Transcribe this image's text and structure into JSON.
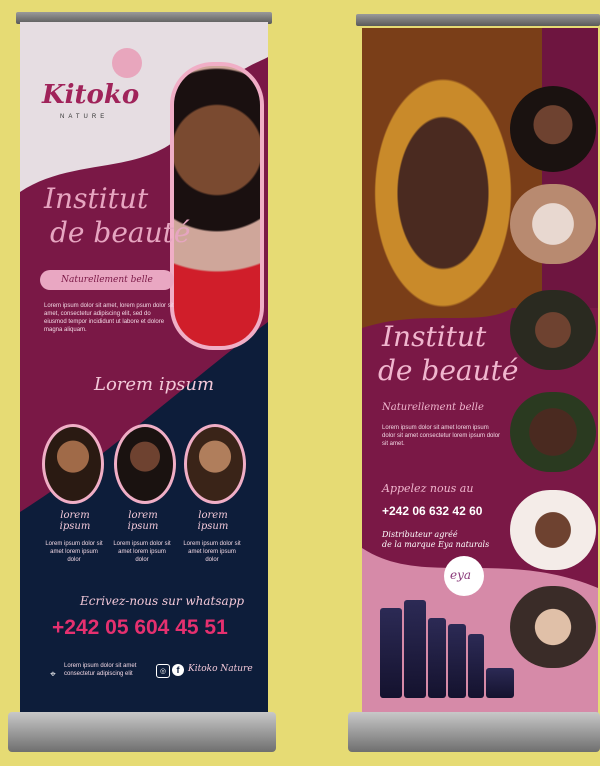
{
  "banner1": {
    "logo": {
      "brand": "Kitoko",
      "sub": "NATURE"
    },
    "title_line1": "Institut",
    "title_line2": "de beauté",
    "tagline": "Naturellement belle",
    "body": "Lorem ipsum dolor sit amet, lorem psum dolor sit amet, consectetur adipiscing elit, sed do eiusmod tempor incididunt ut labore et dolore magna aliquam.",
    "section_heading": "Lorem ipsum",
    "services": [
      {
        "title": "lorem ipsum",
        "text": "Lorem ipsum dolor sit amet lorem ipsum dolor"
      },
      {
        "title": "lorem ipsum",
        "text": "Lorem ipsum dolor sit amet lorem ipsum dolor"
      },
      {
        "title": "lorem ipsum",
        "text": "Lorem ipsum dolor sit amet lorem ipsum dolor"
      }
    ],
    "whatsapp_label": "Ecrivez-nous sur whatsapp",
    "phone": "+242 05 604 45 51",
    "address": "Lorem ipsum dolor sit amet consectetur adipiscing elit",
    "social_name": "Kitoko Nature"
  },
  "banner2": {
    "title_line1": "Institut",
    "title_line2": "de beauté",
    "tagline": "Naturellement belle",
    "body": "Lorem ipsum dolor sit amet lorem ipsum dolor sit amet consectetur lorem ipsum dolor sit amet.",
    "call_label": "Appelez nous au",
    "phone": "+242 06 632 42 60",
    "dealer_line1": "Distributeur agréé",
    "dealer_line2": "de la marque Eya naturals",
    "product_logo": "eya"
  },
  "colors": {
    "wall": "#e6db74",
    "plum": "#7a1846",
    "navy": "#0d1d3a",
    "pink": "#f0aec6",
    "phone_pink": "#e5306f"
  }
}
